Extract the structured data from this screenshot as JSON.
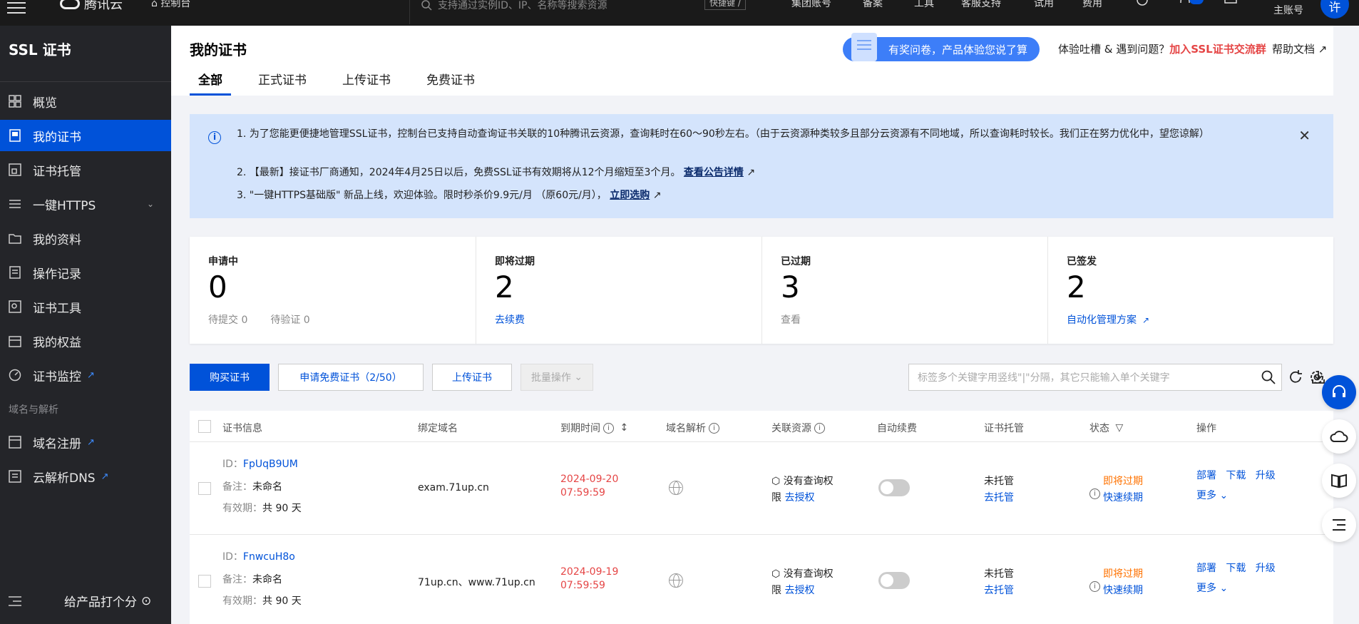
{
  "topbar": {
    "logo_text": "腾讯云",
    "console_label": "控制台",
    "search_placeholder": "支持通过实例ID、IP、名称等搜索资源",
    "shortcut_label": "快捷键 /",
    "nav": [
      "集团账号",
      "备案",
      "工具",
      "客服支持",
      "试用",
      "费用"
    ],
    "account_label": "主账号",
    "avatar_text": "许"
  },
  "sidebar": {
    "title": "SSL 证书",
    "items": [
      {
        "label": "概览",
        "icon": "dashboard-icon"
      },
      {
        "label": "我的证书",
        "icon": "certificate-icon"
      },
      {
        "label": "证书托管",
        "icon": "hosting-icon"
      },
      {
        "label": "一键HTTPS",
        "icon": "https-icon"
      },
      {
        "label": "我的资料",
        "icon": "folder-icon"
      },
      {
        "label": "操作记录",
        "icon": "log-icon"
      },
      {
        "label": "证书工具",
        "icon": "tools-icon"
      },
      {
        "label": "我的权益",
        "icon": "benefits-icon"
      },
      {
        "label": "证书监控",
        "icon": "monitor-icon"
      }
    ],
    "section_label": "域名与解析",
    "section_items": [
      {
        "label": "域名注册",
        "icon": "domain-icon"
      },
      {
        "label": "云解析DNS",
        "icon": "dns-icon"
      }
    ],
    "footer_rate": "给产品打个分"
  },
  "header": {
    "title": "我的证书",
    "survey_text": "有奖问卷，产品体验您说了算",
    "feedback_prefix": "体验吐槽 & 遇到问题？",
    "feedback_link": "加入SSL证书交流群",
    "help_doc": "帮助文档",
    "tabs": [
      "全部",
      "正式证书",
      "上传证书",
      "免费证书"
    ]
  },
  "notice": {
    "line1": "1. 为了您能更便捷地管理SSL证书，控制台已支持自动查询证书关联的10种腾讯云资源，查询耗时在60～90秒左右。（由于云资源种类较多且部分云资源有不同地域，所以查询耗时较长。我们正在努力优化中，望您谅解）",
    "line2": "2. 【最新】接证书厂商通知，2024年4月25日以后，免费SSL证书有效期将从12个月缩短至3个月。",
    "line2_link": "查看公告详情",
    "line3": "3. \"一键HTTPS基础版\" 新品上线，欢迎体验。限时秒杀价9.9元/月 （原60元/月），",
    "line3_link": "立即选购"
  },
  "stats": [
    {
      "label": "申请中",
      "value": "0",
      "sub1": "待提交 0",
      "sub2": "待验证 0"
    },
    {
      "label": "即将过期",
      "value": "2",
      "link": "去续费"
    },
    {
      "label": "已过期",
      "value": "3",
      "muted": "查看"
    },
    {
      "label": "已签发",
      "value": "2",
      "link": "自动化管理方案"
    }
  ],
  "toolbar": {
    "buy": "购买证书",
    "apply_free": "申请免费证书（2/50）",
    "upload": "上传证书",
    "batch": "批量操作",
    "search_placeholder": "标签多个关键字用竖线\"|\"分隔，其它只能输入单个关键字"
  },
  "table": {
    "headers": [
      "证书信息",
      "绑定域名",
      "到期时间",
      "域名解析",
      "关联资源",
      "自动续费",
      "证书托管",
      "状态",
      "操作"
    ],
    "rows": [
      {
        "id_label": "ID：",
        "id": "FpUqB9UM",
        "note_label": "备注：",
        "note": "未命名",
        "validity_label": "有效期：",
        "validity": "共 90 天",
        "domain": "exam.71up.cn",
        "expire_date": "2024-09-20",
        "expire_time": "07:59:59",
        "resource_line1": "没有查询权",
        "resource_line2": "限",
        "resource_link": "去授权",
        "hosting": "未托管",
        "hosting_link": "去托管",
        "status": "即将过期",
        "status_link": "快速续期",
        "actions": [
          "部署",
          "下载",
          "升级"
        ],
        "more": "更多"
      },
      {
        "id_label": "ID：",
        "id": "FnwcuH8o",
        "note_label": "备注：",
        "note": "未命名",
        "validity_label": "有效期：",
        "validity": "共 90 天",
        "domain": "71up.cn、www.71up.cn",
        "expire_date": "2024-09-19",
        "expire_time": "07:59:59",
        "resource_line1": "没有查询权",
        "resource_line2": "限",
        "resource_link": "去授权",
        "hosting": "未托管",
        "hosting_link": "去托管",
        "status": "即将过期",
        "status_link": "快速续期",
        "actions": [
          "部署",
          "下载",
          "升级"
        ],
        "more": "更多"
      }
    ]
  },
  "colors": {
    "primary": "#0052d9",
    "danger": "#e54545",
    "warning": "#ff7200",
    "sidebar_bg": "#242529"
  }
}
